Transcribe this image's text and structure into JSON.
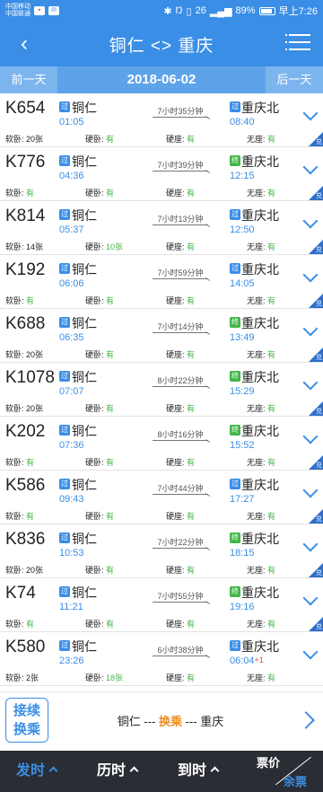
{
  "status": {
    "carrier_top": "中国移动",
    "carrier_bottom": "中国联通",
    "mini_icons": [
      "app-icon-red",
      "message-icon"
    ],
    "network": "26",
    "battery": "89%",
    "time": "早上7:26"
  },
  "header": {
    "back_icon": "back-arrow-icon",
    "title": "铜仁 <> 重庆",
    "menu_icon": "menu-icon"
  },
  "datebar": {
    "prev_label": "前一天",
    "date": "2018-06-02",
    "next_label": "后一天"
  },
  "colors": {
    "primary": "#3a8ee6",
    "pass_tag": "#3a8ee6",
    "end_tag": "#43b548",
    "available": "#43b548",
    "highlight": "#f08c1e"
  },
  "trains": [
    {
      "no": "K654",
      "dep_tag": "过",
      "dep_station": "铜仁",
      "dep_time": "01:05",
      "duration": "7小时35分钟",
      "arr_tag": "过",
      "arr_tag_type": "pass",
      "arr_station": "重庆北",
      "arr_time": "08:40",
      "plus": "",
      "soft_sleeper": "20张",
      "hard_sleeper": "有",
      "hard_seat": "有",
      "no_seat": "有",
      "corner": "兑"
    },
    {
      "no": "K776",
      "dep_tag": "过",
      "dep_station": "铜仁",
      "dep_time": "04:36",
      "duration": "7小时39分钟",
      "arr_tag": "终",
      "arr_tag_type": "end",
      "arr_station": "重庆北",
      "arr_time": "12:15",
      "plus": "",
      "soft_sleeper": "有",
      "hard_sleeper": "有",
      "hard_seat": "有",
      "no_seat": "有",
      "corner": "兑"
    },
    {
      "no": "K814",
      "dep_tag": "过",
      "dep_station": "铜仁",
      "dep_time": "05:37",
      "duration": "7小时13分钟",
      "arr_tag": "过",
      "arr_tag_type": "pass",
      "arr_station": "重庆北",
      "arr_time": "12:50",
      "plus": "",
      "soft_sleeper": "14张",
      "hard_sleeper": "10张",
      "hard_seat": "有",
      "no_seat": "有",
      "corner": "兑"
    },
    {
      "no": "K192",
      "dep_tag": "过",
      "dep_station": "铜仁",
      "dep_time": "06:06",
      "duration": "7小时59分钟",
      "arr_tag": "过",
      "arr_tag_type": "pass",
      "arr_station": "重庆北",
      "arr_time": "14:05",
      "plus": "",
      "soft_sleeper": "有",
      "hard_sleeper": "有",
      "hard_seat": "有",
      "no_seat": "有",
      "corner": "兑"
    },
    {
      "no": "K688",
      "dep_tag": "过",
      "dep_station": "铜仁",
      "dep_time": "06:35",
      "duration": "7小时14分钟",
      "arr_tag": "终",
      "arr_tag_type": "end",
      "arr_station": "重庆北",
      "arr_time": "13:49",
      "plus": "",
      "soft_sleeper": "20张",
      "hard_sleeper": "有",
      "hard_seat": "有",
      "no_seat": "有",
      "corner": "兑"
    },
    {
      "no": "K1078",
      "dep_tag": "过",
      "dep_station": "铜仁",
      "dep_time": "07:07",
      "duration": "8小时22分钟",
      "arr_tag": "终",
      "arr_tag_type": "end",
      "arr_station": "重庆北",
      "arr_time": "15:29",
      "plus": "",
      "soft_sleeper": "20张",
      "hard_sleeper": "有",
      "hard_seat": "有",
      "no_seat": "有",
      "corner": "兑"
    },
    {
      "no": "K202",
      "dep_tag": "过",
      "dep_station": "铜仁",
      "dep_time": "07:36",
      "duration": "8小时16分钟",
      "arr_tag": "终",
      "arr_tag_type": "end",
      "arr_station": "重庆北",
      "arr_time": "15:52",
      "plus": "",
      "soft_sleeper": "有",
      "hard_sleeper": "有",
      "hard_seat": "有",
      "no_seat": "有",
      "corner": "兑"
    },
    {
      "no": "K586",
      "dep_tag": "过",
      "dep_station": "铜仁",
      "dep_time": "09:43",
      "duration": "7小时44分钟",
      "arr_tag": "过",
      "arr_tag_type": "pass",
      "arr_station": "重庆北",
      "arr_time": "17:27",
      "plus": "",
      "soft_sleeper": "有",
      "hard_sleeper": "有",
      "hard_seat": "有",
      "no_seat": "有",
      "corner": "兑"
    },
    {
      "no": "K836",
      "dep_tag": "过",
      "dep_station": "铜仁",
      "dep_time": "10:53",
      "duration": "7小时22分钟",
      "arr_tag": "终",
      "arr_tag_type": "end",
      "arr_station": "重庆北",
      "arr_time": "18:15",
      "plus": "",
      "soft_sleeper": "20张",
      "hard_sleeper": "有",
      "hard_seat": "有",
      "no_seat": "有",
      "corner": "兑"
    },
    {
      "no": "K74",
      "dep_tag": "过",
      "dep_station": "铜仁",
      "dep_time": "11:21",
      "duration": "7小时55分钟",
      "arr_tag": "终",
      "arr_tag_type": "end",
      "arr_station": "重庆北",
      "arr_time": "19:16",
      "plus": "",
      "soft_sleeper": "有",
      "hard_sleeper": "有",
      "hard_seat": "有",
      "no_seat": "有",
      "corner": "兑"
    },
    {
      "no": "K580",
      "dep_tag": "过",
      "dep_station": "铜仁",
      "dep_time": "23:26",
      "duration": "6小时38分钟",
      "arr_tag": "过",
      "arr_tag_type": "pass",
      "arr_station": "重庆北",
      "arr_time": "06:04",
      "plus": "+1",
      "soft_sleeper": "2张",
      "hard_sleeper": "18张",
      "hard_seat": "有",
      "no_seat": "有",
      "corner": ""
    }
  ],
  "seat_labels": {
    "soft_sleeper": "软卧: ",
    "hard_sleeper": "硬卧: ",
    "hard_seat": "硬座: ",
    "no_seat": "无座: "
  },
  "transfer": {
    "badge_line1": "接续",
    "badge_line2": "换乘",
    "from": "铜仁",
    "sep1": " --- ",
    "middle": "换乘",
    "sep2": " --- ",
    "to": "重庆",
    "arrow_icon": "chevron-right-icon"
  },
  "bottom_tabs": {
    "depart": "发时",
    "duration": "历时",
    "arrive": "到时",
    "price": "票价",
    "remaining": "余票"
  }
}
